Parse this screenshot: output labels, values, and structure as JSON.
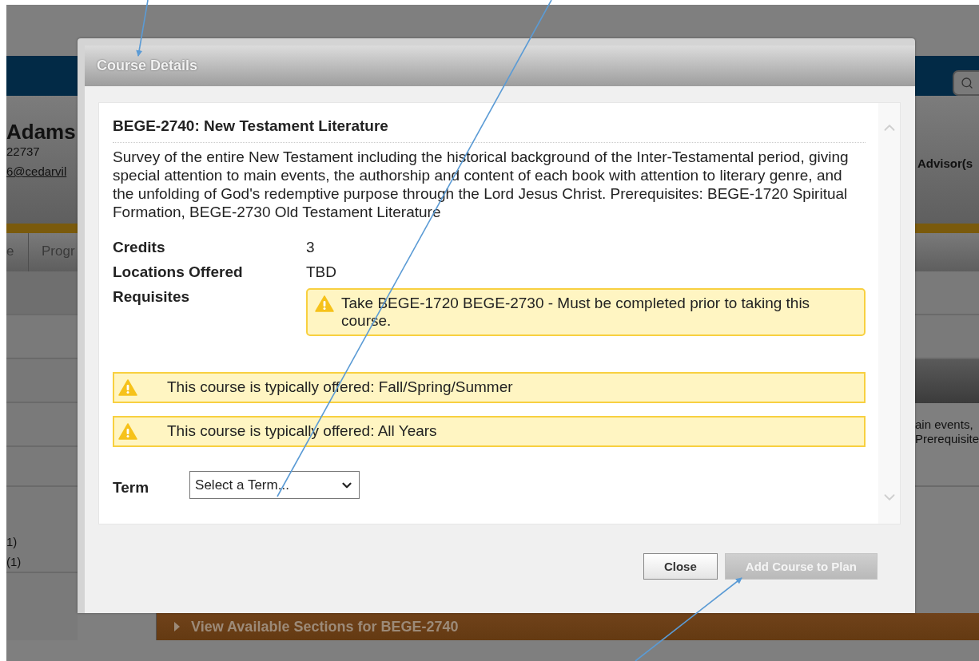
{
  "background_page": {
    "student_name": "Adams",
    "student_id": "22737",
    "email": "6@cedarvil",
    "advisor_label": "Advisor(s",
    "tabs": [
      {
        "label": "e"
      },
      {
        "label": "Progr"
      }
    ],
    "left_counts": [
      "1)",
      "(1)"
    ],
    "description_fragments": [
      "ain events,",
      "Prerequisite"
    ],
    "sections_link": "View Available Sections for BEGE-2740"
  },
  "dialog": {
    "title": "Course Details",
    "course_title": "BEGE-2740: New Testament Literature",
    "description": "Survey of the entire New Testament including the historical background of the Inter-Testamental period, giving special attention to main events, the authorship and content of each book with attention to literary genre, and the unfolding of God's redemptive purpose through the Lord Jesus Christ. Prerequisites: BEGE-1720 Spiritual Formation, BEGE-2730 Old Testament Literature",
    "details": [
      {
        "label": "Credits",
        "kind": "text",
        "value": "3"
      },
      {
        "label": "Locations Offered",
        "kind": "text",
        "value": "TBD"
      },
      {
        "label": "Requisites",
        "kind": "notice",
        "value": "Take BEGE-1720 BEGE-2730 - Must be completed prior to taking this course."
      }
    ],
    "notices": [
      "This course is typically offered: Fall/Spring/Summer",
      "This course is typically offered: All Years"
    ],
    "term": {
      "label": "Term",
      "value": "Select a Term..."
    },
    "buttons": [
      {
        "label": "Close",
        "disabled": false
      },
      {
        "label": "Add Course to Plan",
        "disabled": true
      }
    ]
  }
}
